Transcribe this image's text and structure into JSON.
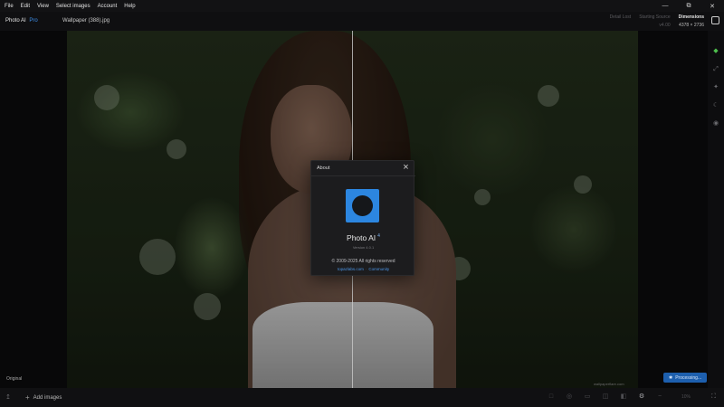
{
  "menu": {
    "items": [
      "File",
      "Edit",
      "View",
      "Select images",
      "Account",
      "Help"
    ]
  },
  "window_controls": {
    "minimize_icon": "minimize-icon",
    "restore_icon": "restore-icon",
    "close_icon": "close-icon"
  },
  "header": {
    "app_name": "Photo AI",
    "edition": "Pro",
    "file_name": "Wallpaper (388).jpg",
    "stats": [
      {
        "label": "Detail Lost",
        "value": ""
      },
      {
        "label": "Starting Source",
        "value": "v4.00"
      },
      {
        "label": "Dimensions",
        "value": "4378 × 2736"
      }
    ]
  },
  "canvas": {
    "original_label": "Original",
    "watermark": "wallpaperflare.com",
    "processing_label": "Processing..."
  },
  "bottom": {
    "add_images_label": "Add images",
    "zoom_label": "10%"
  },
  "about": {
    "title": "About",
    "app_name": "Photo AI",
    "major_version": "4",
    "version": "Version 4.0.1",
    "copyright": "© 2009-2025 All rights reserved",
    "links": [
      "topazlabs.com",
      "Community"
    ]
  },
  "colors": {
    "accent": "#2c86e0",
    "pro_label": "#3d8ee8",
    "link": "#4b95e6",
    "processing_bg": "#1d5fae",
    "active_tool": "#4ec04e"
  }
}
